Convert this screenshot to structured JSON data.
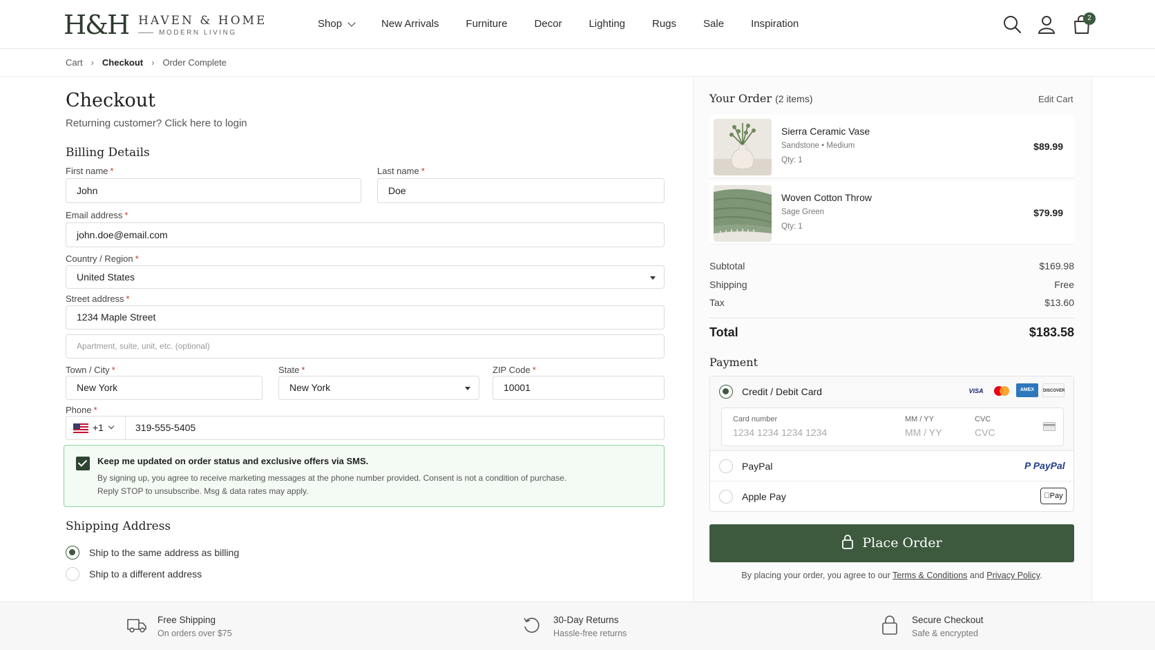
{
  "brand": {
    "mark": "H&H",
    "name": "HAVEN & HOME",
    "tagline": "MODERN LIVING"
  },
  "nav": [
    "Shop",
    "New Arrivals",
    "Furniture",
    "Decor",
    "Lighting",
    "Rugs",
    "Sale",
    "Inspiration"
  ],
  "cart_count": "2",
  "breadcrumb": {
    "step1": "Cart",
    "step2": "Checkout",
    "step3": "Order Complete"
  },
  "checkout": {
    "title": "Checkout",
    "returning_text": "Returning customer?",
    "login_link": "Click here to login",
    "billing_title": "Billing Details",
    "first_name_label": "First name",
    "first_name": "John",
    "last_name_label": "Last name",
    "last_name": "Doe",
    "email_label": "Email address",
    "email": "john.doe@email.com",
    "country_label": "Country / Region",
    "country": "United States",
    "street_label": "Street address",
    "street": "1234 Maple Street",
    "apt_placeholder": "Apartment, suite, unit, etc. (optional)",
    "city_label": "Town / City",
    "city": "New York",
    "state_label": "State",
    "state": "New York",
    "zip_label": "ZIP Code",
    "zip": "10001",
    "phone_label": "Phone",
    "phone_code": "+1",
    "phone": "319-555-5405",
    "required_mark": "*"
  },
  "sms": {
    "title": "Keep me updated on order status and exclusive offers via SMS.",
    "line1": "By signing up, you agree to receive marketing messages at the phone number provided. Consent is not a condition of purchase.",
    "line2": "Reply STOP to unsubscribe. Msg & data rates may apply.",
    "checked": true
  },
  "shipping": {
    "title": "Shipping Address",
    "option_same": "Ship to the same address as billing",
    "option_different": "Ship to a different address"
  },
  "order": {
    "title": "Your Order",
    "count": "(2 items)",
    "edit": "Edit Cart",
    "items": [
      {
        "name": "Sierra Ceramic Vase",
        "meta": "Sandstone  •  Medium",
        "qty": "Qty: 1",
        "price": "$89.99"
      },
      {
        "name": "Woven Cotton Throw",
        "meta": "Sage Green",
        "qty": "Qty: 1",
        "price": "$79.99"
      }
    ],
    "subtotal_label": "Subtotal",
    "subtotal": "$169.98",
    "shipping_label": "Shipping",
    "shipping": "Free",
    "tax_label": "Tax",
    "tax": "$13.60",
    "total_label": "Total",
    "total": "$183.58"
  },
  "payment": {
    "title": "Payment",
    "card_label": "Credit / Debit Card",
    "card_brands": [
      "VISA",
      "MC",
      "AMEX",
      "DISCOVER"
    ],
    "card_number_label": "Card number",
    "card_number_placeholder": "1234 1234 1234 1234",
    "expiry_label": "MM / YY",
    "expiry_placeholder": "MM / YY",
    "cvc_label": "CVC",
    "cvc_placeholder": "CVC",
    "paypal_label": "PayPal",
    "paypal_logo": "PayPal",
    "applepay_label": "Apple Pay",
    "applepay_logo": "Pay"
  },
  "place_order": "Place Order",
  "agreement": {
    "prefix": "By placing your order, you agree to our",
    "terms": "Terms & Conditions",
    "and": "and",
    "privacy": "Privacy Policy",
    "suffix": "."
  },
  "footer": [
    {
      "title": "Free Shipping",
      "sub": "On orders over $75",
      "icon": "truck-icon"
    },
    {
      "title": "30-Day Returns",
      "sub": "Hassle-free returns",
      "icon": "return-icon"
    },
    {
      "title": "Secure Checkout",
      "sub": "Safe & encrypted",
      "icon": "lock-icon"
    }
  ],
  "colors": {
    "accent": "#3d5a3f",
    "sms_border": "#8ad39b",
    "sms_bg": "#f3fbf4"
  }
}
